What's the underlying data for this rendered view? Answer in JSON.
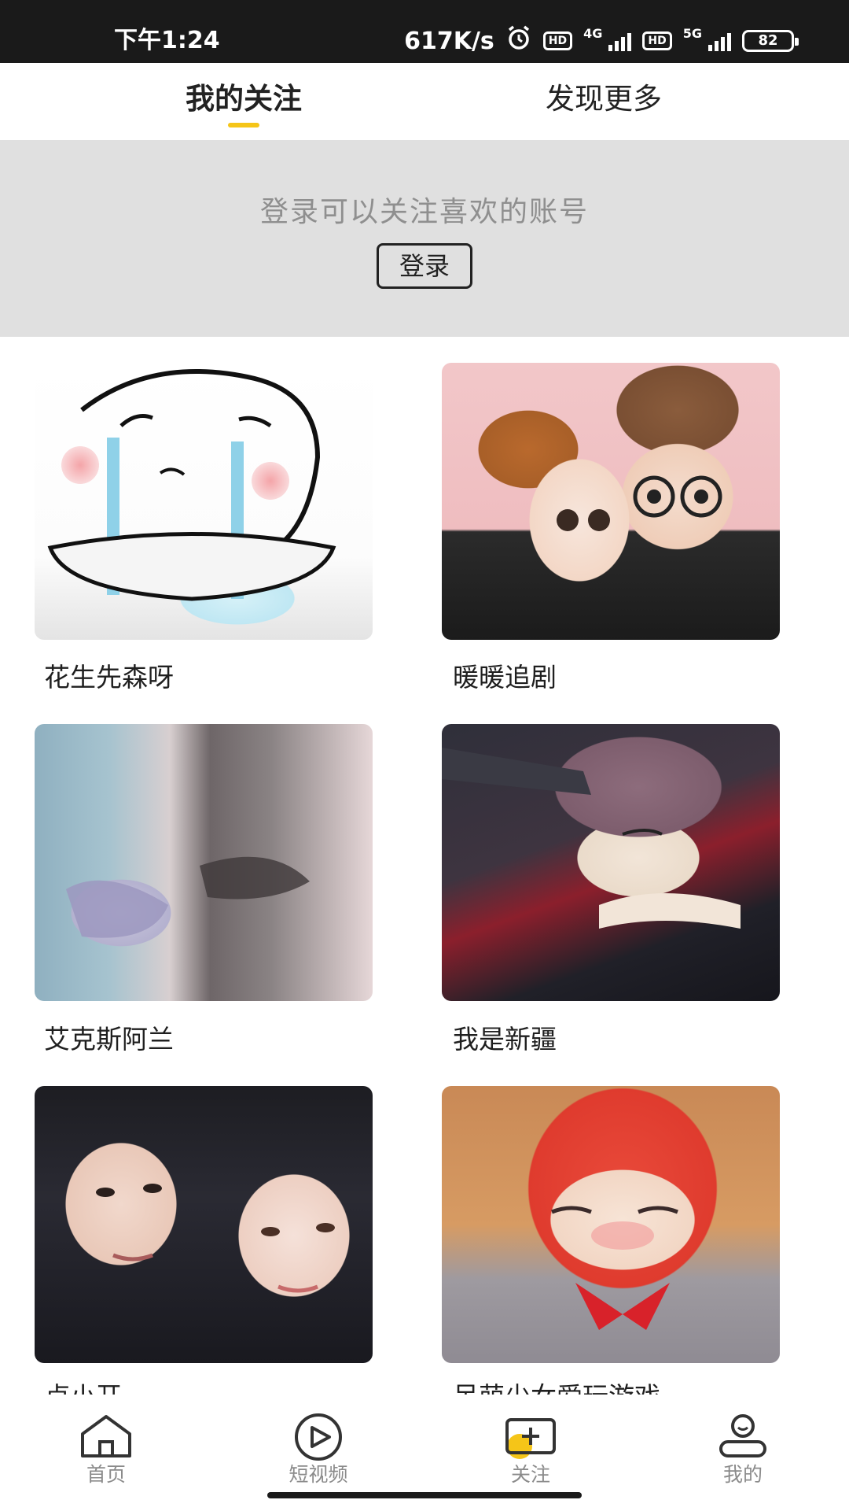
{
  "status_bar": {
    "time": "下午1:24",
    "net_speed": "617K/s",
    "hd1": "HD",
    "net1": "4G",
    "hd2": "HD",
    "net2": "5G",
    "battery": "82"
  },
  "tabs": {
    "active": "我的关注",
    "other": "发现更多",
    "indicator_color": "#f5c518"
  },
  "login": {
    "prompt": "登录可以关注喜欢的账号",
    "button": "登录"
  },
  "accounts": [
    {
      "name": "花生先森呀",
      "icon": "crying-cartoon-avatar"
    },
    {
      "name": "暖暖追剧",
      "icon": "cartoon-couple-avatar"
    },
    {
      "name": "艾克斯阿兰",
      "icon": "legs-photo-avatar"
    },
    {
      "name": "我是新疆",
      "icon": "anime-boy-avatar"
    },
    {
      "name": "卢小开",
      "icon": "couple-photo-avatar"
    },
    {
      "name": "呆萌少女爱玩游戏",
      "icon": "anime-girl-avatar"
    }
  ],
  "bottom_nav": [
    {
      "label": "首页",
      "icon": "home-icon"
    },
    {
      "label": "短视频",
      "icon": "play-icon"
    },
    {
      "label": "关注",
      "icon": "follow-add-icon"
    },
    {
      "label": "我的",
      "icon": "profile-icon"
    }
  ]
}
